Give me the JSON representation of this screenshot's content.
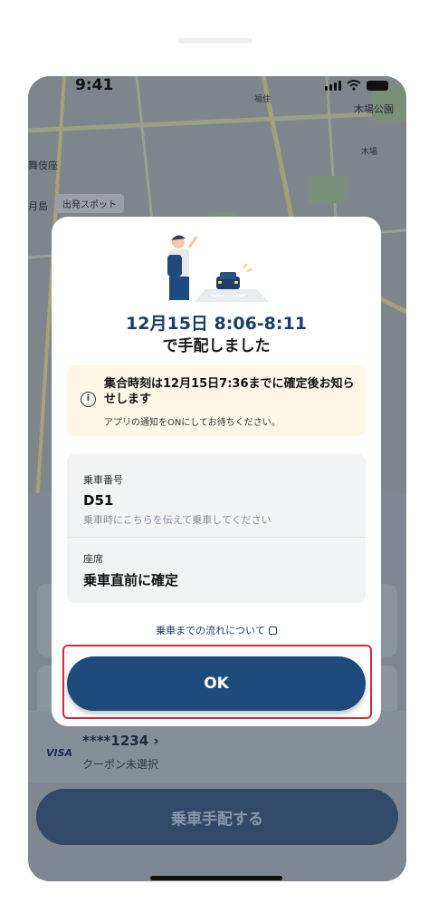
{
  "status_bar": {
    "time": "9:41"
  },
  "map": {
    "labels": [
      "木場公園",
      "舞伎座",
      "月島",
      "福住",
      "木場"
    ],
    "chip": "出発スポット"
  },
  "modal": {
    "title_line1": "12月15日 8:06-8:11",
    "title_line2": "で手配しました",
    "notice": {
      "icon": "info-icon",
      "title": "集合時刻は12月15日7:36までに確定後お知らせします",
      "subtitle": "アプリの通知をONにしてお待ちください。"
    },
    "boarding_number": {
      "label": "乗車番号",
      "value": "D51",
      "note": "乗車時にこちらを伝えて乗車してください"
    },
    "seat": {
      "label": "座席",
      "value": "乗車直前に確定"
    },
    "flow_link": "乗車までの流れについて",
    "ok_label": "OK"
  },
  "background": {
    "payment": {
      "brand": "VISA",
      "card": "****1234 ›",
      "coupon": "クーポン未選択"
    },
    "request_button": "乗車手配する"
  },
  "colors": {
    "primary": "#1f4a7c",
    "highlight": "#d0293a",
    "notice_bg": "#fdf8e6"
  }
}
